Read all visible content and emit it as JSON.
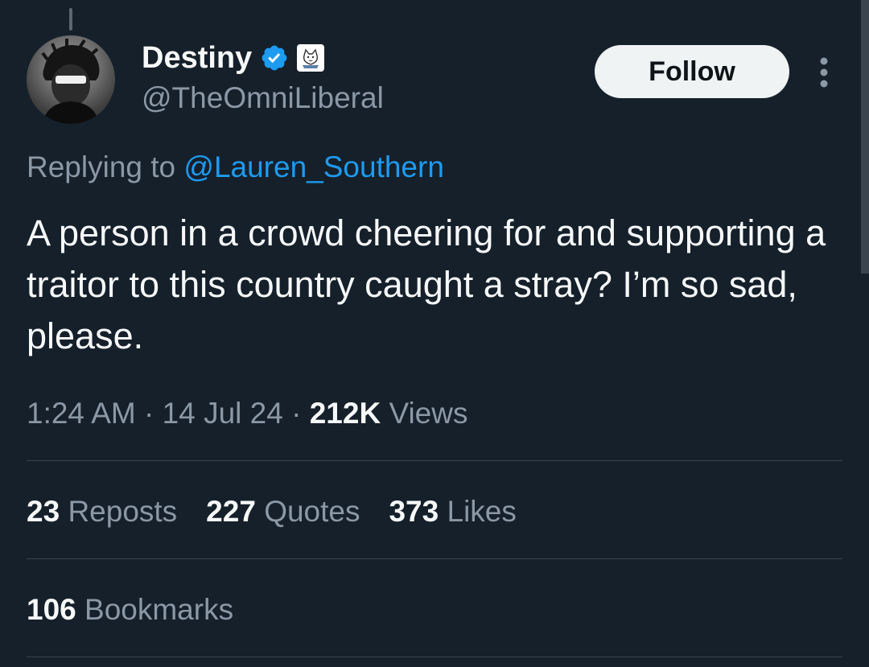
{
  "author": {
    "display_name": "Destiny",
    "handle": "@TheOmniLiberal"
  },
  "follow_label": "Follow",
  "reply": {
    "prefix": "Replying to",
    "mention": "@Lauren_Southern"
  },
  "tweet": {
    "text": "A person in a crowd cheering for and supporting a traitor to this country caught a stray? I’m so sad, please.",
    "time": "1:24 AM",
    "date": "14 Jul 24",
    "views_count": "212K",
    "views_label": "Views"
  },
  "stats": {
    "reposts_count": "23",
    "reposts_label": "Reposts",
    "quotes_count": "227",
    "quotes_label": "Quotes",
    "likes_count": "373",
    "likes_label": "Likes",
    "bookmarks_count": "106",
    "bookmarks_label": "Bookmarks"
  },
  "colors": {
    "background": "#15202b",
    "accent": "#1d9bf0",
    "secondary_text": "#8b98a5",
    "primary_text": "#f7f9f9"
  }
}
